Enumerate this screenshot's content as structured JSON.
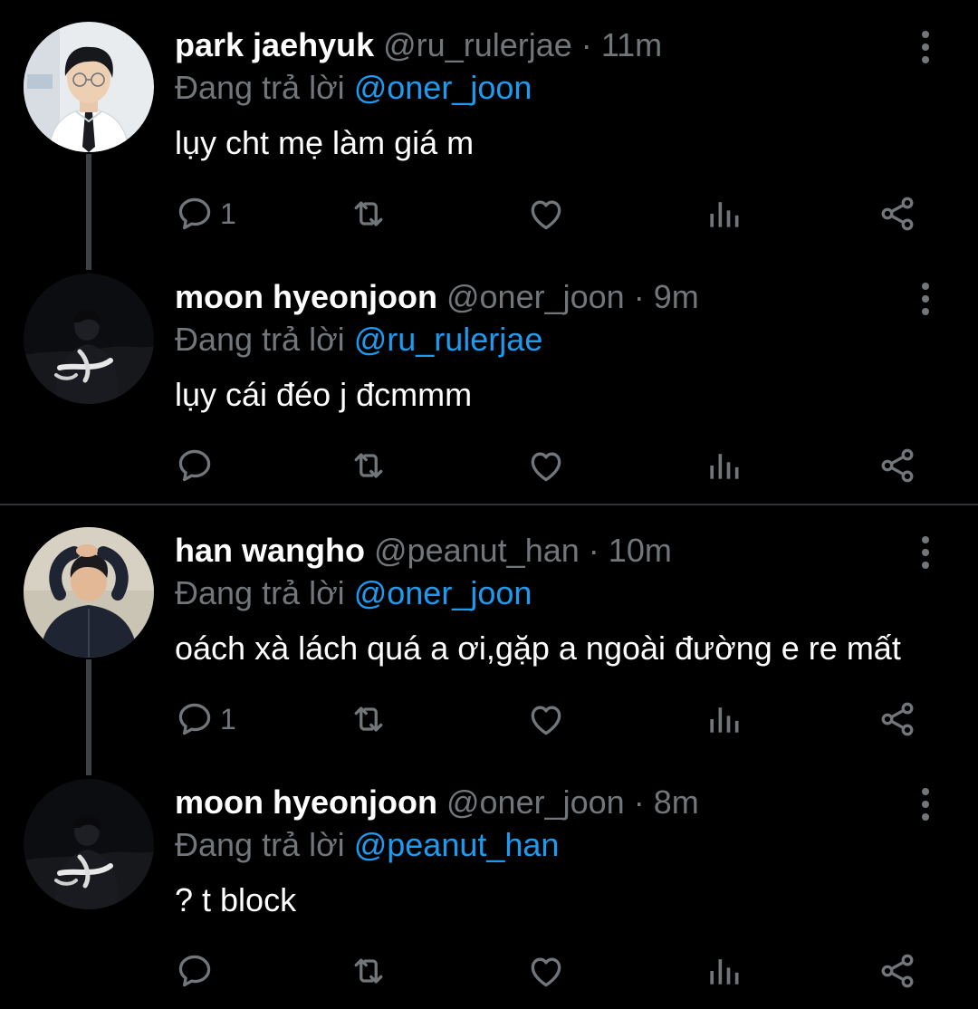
{
  "threads": [
    {
      "tweets": [
        {
          "name": "park jaehyuk",
          "handle": "@ru_rulerjae",
          "separator": "·",
          "time": "11m",
          "replying_label": "Đang trả lời",
          "replying_to": "@oner_joon",
          "text": "lụy cht mẹ làm giá m",
          "reply_count": "1",
          "avatar": "avatar-office-man"
        },
        {
          "name": "moon hyeonjoon",
          "handle": "@oner_joon",
          "separator": "·",
          "time": "9m",
          "replying_label": "Đang trả lời",
          "replying_to": "@ru_rulerjae",
          "text": "lụy cái đéo j đcmmm",
          "reply_count": "",
          "avatar": "avatar-night-photo"
        }
      ]
    },
    {
      "tweets": [
        {
          "name": "han wangho",
          "handle": "@peanut_han",
          "separator": "·",
          "time": "10m",
          "replying_label": "Đang trả lời",
          "replying_to": "@oner_joon",
          "text": "oách xà lách quá a ơi,gặp a ngoài đường e re mất",
          "reply_count": "1",
          "avatar": "avatar-arms-up"
        },
        {
          "name": "moon hyeonjoon",
          "handle": "@oner_joon",
          "separator": "·",
          "time": "8m",
          "replying_label": "Đang trả lời",
          "replying_to": "@peanut_han",
          "text": "? t block",
          "reply_count": "",
          "avatar": "avatar-night-photo"
        }
      ]
    }
  ],
  "icons": {
    "reply": "reply-icon",
    "retweet": "retweet-icon",
    "like": "like-icon",
    "views": "views-icon",
    "share": "share-icon",
    "more": "more-vertical-icon"
  },
  "colors": {
    "background": "#000000",
    "name": "#ffffff",
    "muted": "#71767b",
    "mention": "#1d9bf0",
    "divider": "#2f3336"
  }
}
